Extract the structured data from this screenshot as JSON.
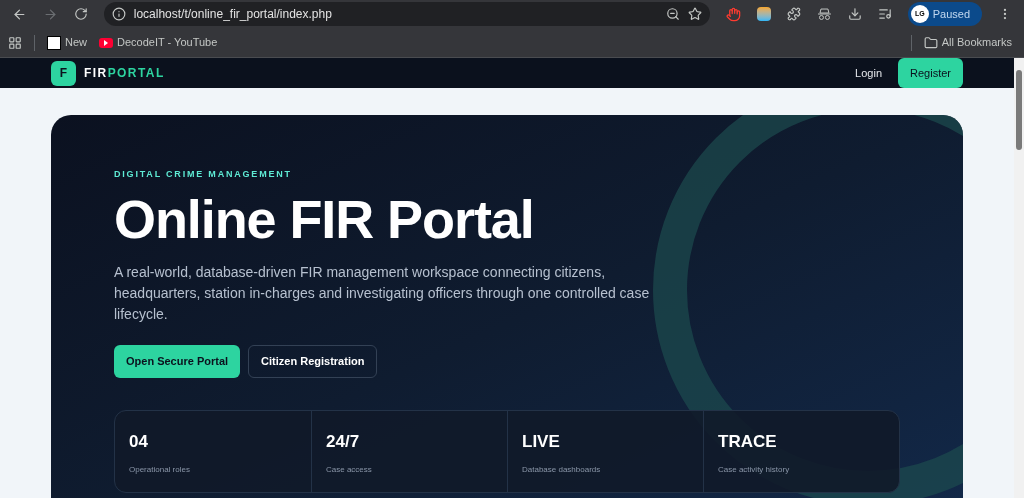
{
  "browser": {
    "url": "localhost/t/online_fir_portal/index.php",
    "profile_initials": "LG",
    "profile_status": "Paused",
    "bookmarks": [
      {
        "label": "New",
        "kind": "logo"
      },
      {
        "label": "DecodeIT - YouTube",
        "kind": "youtube"
      }
    ],
    "all_bookmarks": "All Bookmarks"
  },
  "navbar": {
    "brand_letter": "F",
    "brand_first": "FIR",
    "brand_second": "PORTAL",
    "login": "Login",
    "register": "Register"
  },
  "hero": {
    "eyebrow": "DIGITAL CRIME MANAGEMENT",
    "title": "Online FIR Portal",
    "description": "A real-world, database-driven FIR management workspace connecting citizens, headquarters, station in-charges and investigating officers through one controlled case lifecycle.",
    "primary_button": "Open Secure Portal",
    "secondary_button": "Citizen Registration",
    "stats": [
      {
        "value": "04",
        "label": "Operational roles"
      },
      {
        "value": "24/7",
        "label": "Case access"
      },
      {
        "value": "LIVE",
        "label": "Database dashboards"
      },
      {
        "value": "TRACE",
        "label": "Case activity history"
      }
    ]
  }
}
